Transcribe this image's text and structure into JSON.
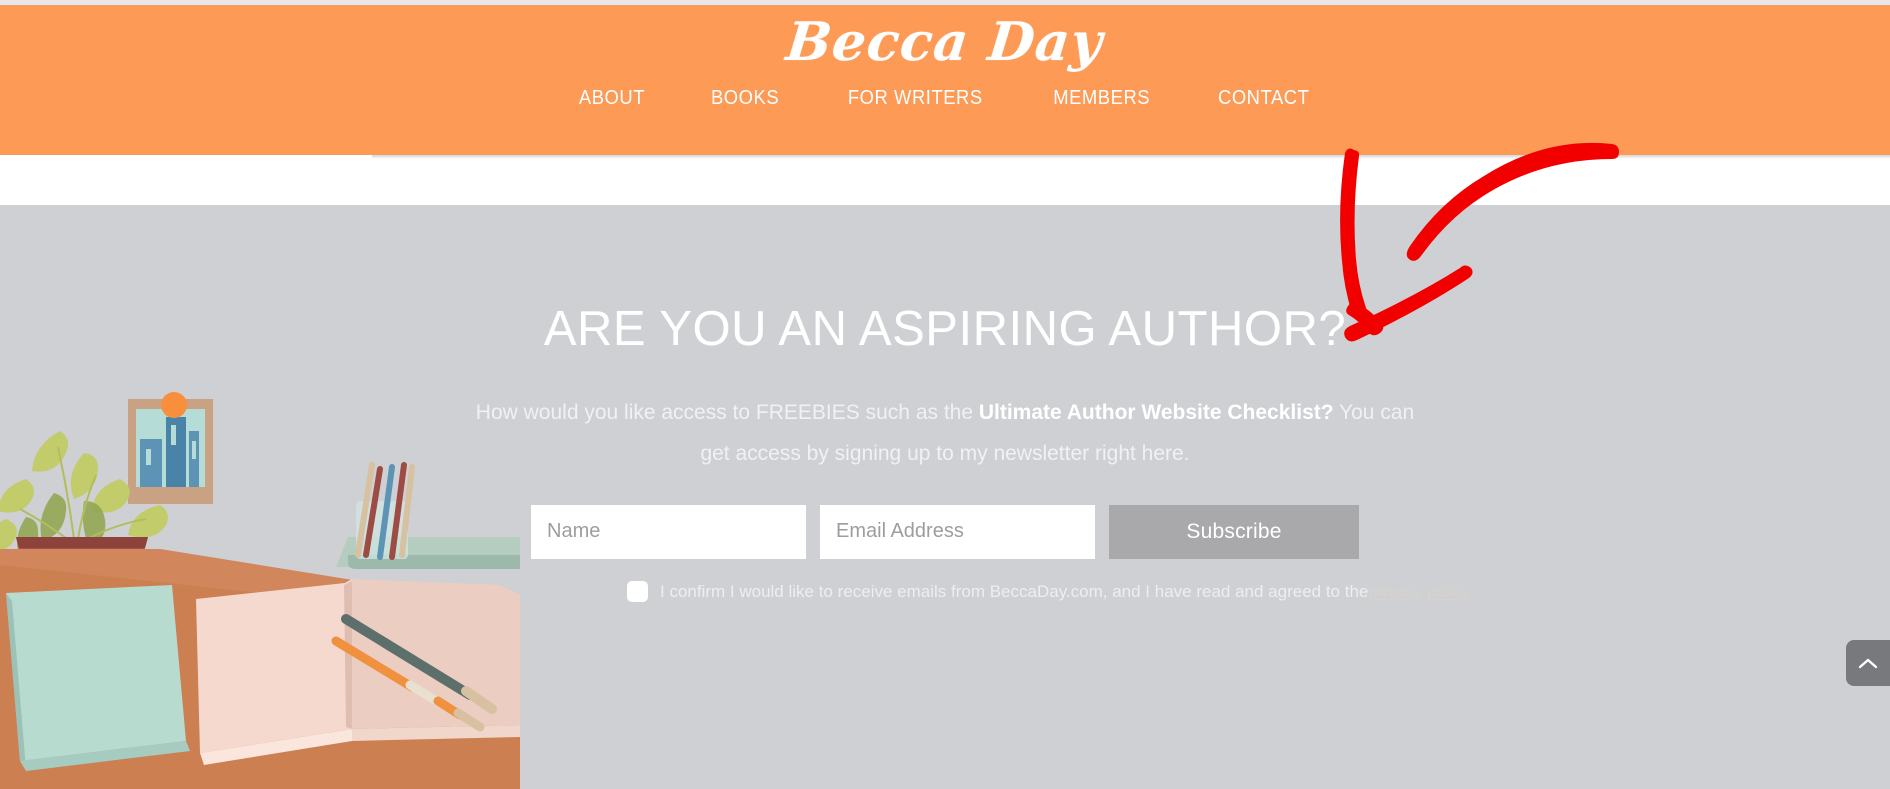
{
  "site": {
    "logo_text": "Becca Day",
    "brand_orange": "#fd9a56",
    "section_gray": "#ced0d4"
  },
  "nav": {
    "items": [
      {
        "label": "ABOUT"
      },
      {
        "label": "BOOKS"
      },
      {
        "label": "FOR WRITERS"
      },
      {
        "label": "MEMBERS"
      },
      {
        "label": "CONTACT"
      }
    ]
  },
  "cta": {
    "heading": "ARE YOU AN ASPIRING AUTHOR?",
    "paragraph_part1": "How would you like access to FREEBIES such as the ",
    "paragraph_bold": "Ultimate Author Website Checklist?",
    "paragraph_part2": " You can get access by signing up to my newsletter right here.",
    "form": {
      "name_placeholder": "Name",
      "email_placeholder": "Email Address",
      "name_value": "",
      "email_value": "",
      "subscribe_label": "Subscribe",
      "subscribe_color": "#a9a9ab"
    },
    "consent": {
      "checked": false,
      "text": "I confirm I would like to receive emails from BeccaDay.com, and I have read and agreed to the",
      "link_label": "privacy policy."
    }
  },
  "annotation": {
    "arrow_color": "#f20000",
    "icon": "hand-drawn-arrow-pointing-down-left"
  },
  "scroll_top": {
    "icon": "chevron-up-icon",
    "color": "#78797d"
  },
  "illustration": {
    "name": "desk-with-books-and-plant",
    "colors": {
      "desk": "#cc7f51",
      "wall": "#ced0d4",
      "plant_pot": "#a85149",
      "leaves": "#c2cc6b",
      "book_closed": "#b8dbd0",
      "book_open": "#f5d9ce",
      "frame": "#c9a183",
      "tray": "#b4cdc0",
      "accent_dot": "#f98f3d"
    }
  }
}
